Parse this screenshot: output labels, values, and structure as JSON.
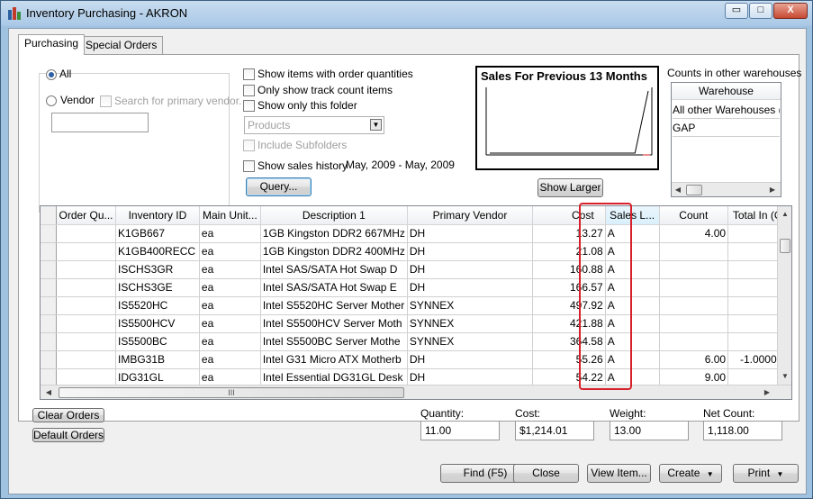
{
  "window": {
    "title": "Inventory Purchasing - AKRON",
    "minimize_glyph": "▭",
    "maximize_glyph": "□",
    "close_glyph": "X"
  },
  "tabs": [
    {
      "label": "Purchasing",
      "active": true
    },
    {
      "label": "Special Orders",
      "active": false
    }
  ],
  "filters": {
    "all_label": "All",
    "vendor_label": "Vendor",
    "search_primary_vendor_label": "Search for primary vendor.",
    "vendor_value": "",
    "show_items_with_order_quantities": "Show items with order quantities",
    "only_show_track_count_items": "Only show track count items",
    "show_only_this_folder": "Show only this folder",
    "folder_select_value": "Products",
    "include_subfolders": "Include Subfolders",
    "show_sales_history": "Show sales history",
    "sales_history_range": "May, 2009 - May, 2009",
    "query_button": "Query..."
  },
  "sales_chart": {
    "title": "Sales For Previous 13 Months",
    "show_larger_button": "Show Larger"
  },
  "chart_data": {
    "type": "line",
    "title": "Sales For Previous 13 Months",
    "x": [
      1,
      2,
      3,
      4,
      5,
      6,
      7,
      8,
      9,
      10,
      11,
      12,
      13
    ],
    "series": [
      {
        "values": [
          0,
          0,
          0,
          0,
          0,
          0,
          0,
          0,
          0,
          0,
          0,
          0,
          100
        ]
      }
    ],
    "ylim": [
      0,
      100
    ],
    "line_color": "#000000",
    "grid": false
  },
  "warehouses": {
    "heading": "Counts in other warehouses",
    "column_header": "Warehouse",
    "rows": [
      "All other Warehouses (tot",
      "GAP"
    ]
  },
  "grid": {
    "columns": [
      "Order Qu...",
      "Inventory ID",
      "Main Unit...",
      "Description 1",
      "Primary Vendor",
      "Cost",
      "Sales L...",
      "Count",
      "Total In (Or"
    ],
    "rows": [
      {
        "order_qty": "",
        "id": "K1GB667",
        "unit": "ea",
        "desc": "1GB Kingston DDR2 667MHz",
        "vendor": "DH",
        "cost": "13.27",
        "sales_level": "A",
        "count": "4.00",
        "total_in": ""
      },
      {
        "order_qty": "",
        "id": "K1GB400RECC",
        "unit": "ea",
        "desc": "1GB Kingston DDR2 400MHz",
        "vendor": "DH",
        "cost": "21.08",
        "sales_level": "A",
        "count": "",
        "total_in": ""
      },
      {
        "order_qty": "",
        "id": "ISCHS3GR",
        "unit": "ea",
        "desc": "Intel SAS/SATA Hot Swap D",
        "vendor": "DH",
        "cost": "160.88",
        "sales_level": "A",
        "count": "",
        "total_in": ""
      },
      {
        "order_qty": "",
        "id": "ISCHS3GE",
        "unit": "ea",
        "desc": "Intel SAS/SATA Hot Swap E",
        "vendor": "DH",
        "cost": "166.57",
        "sales_level": "A",
        "count": "",
        "total_in": ""
      },
      {
        "order_qty": "",
        "id": "IS5520HC",
        "unit": "ea",
        "desc": "Intel S5520HC Server Mother",
        "vendor": "SYNNEX",
        "cost": "497.92",
        "sales_level": "A",
        "count": "",
        "total_in": ""
      },
      {
        "order_qty": "",
        "id": "IS5500HCV",
        "unit": "ea",
        "desc": "Intel S5500HCV Server Moth",
        "vendor": "SYNNEX",
        "cost": "421.88",
        "sales_level": "A",
        "count": "",
        "total_in": ""
      },
      {
        "order_qty": "",
        "id": "IS5500BC",
        "unit": "ea",
        "desc": "Intel S5500BC Server Mothe",
        "vendor": "SYNNEX",
        "cost": "364.58",
        "sales_level": "A",
        "count": "",
        "total_in": ""
      },
      {
        "order_qty": "",
        "id": "IMBG31B",
        "unit": "ea",
        "desc": "Intel G31 Micro ATX Motherb",
        "vendor": "DH",
        "cost": "55.26",
        "sales_level": "A",
        "count": "6.00",
        "total_in": "-1.000000"
      },
      {
        "order_qty": "",
        "id": "IDG31GL",
        "unit": "ea",
        "desc": "Intel Essential DG31GL Desk",
        "vendor": "DH",
        "cost": "54.22",
        "sales_level": "A",
        "count": "9.00",
        "total_in": ""
      }
    ],
    "hscroll_grip": "III"
  },
  "buttons": {
    "clear_orders": "Clear Orders",
    "default_orders": "Default Orders",
    "find": "Find (F5)",
    "close": "Close",
    "view_item": "View Item...",
    "create": "Create",
    "print": "Print"
  },
  "totals": {
    "quantity_label": "Quantity:",
    "quantity_value": "11.00",
    "cost_label": "Cost:",
    "cost_value": "$1,214.01",
    "weight_label": "Weight:",
    "weight_value": "13.00",
    "net_count_label": "Net Count:",
    "net_count_value": "1,118.00"
  },
  "colors": {
    "highlight": "#d8202a",
    "accent": "#2f5fa6"
  }
}
